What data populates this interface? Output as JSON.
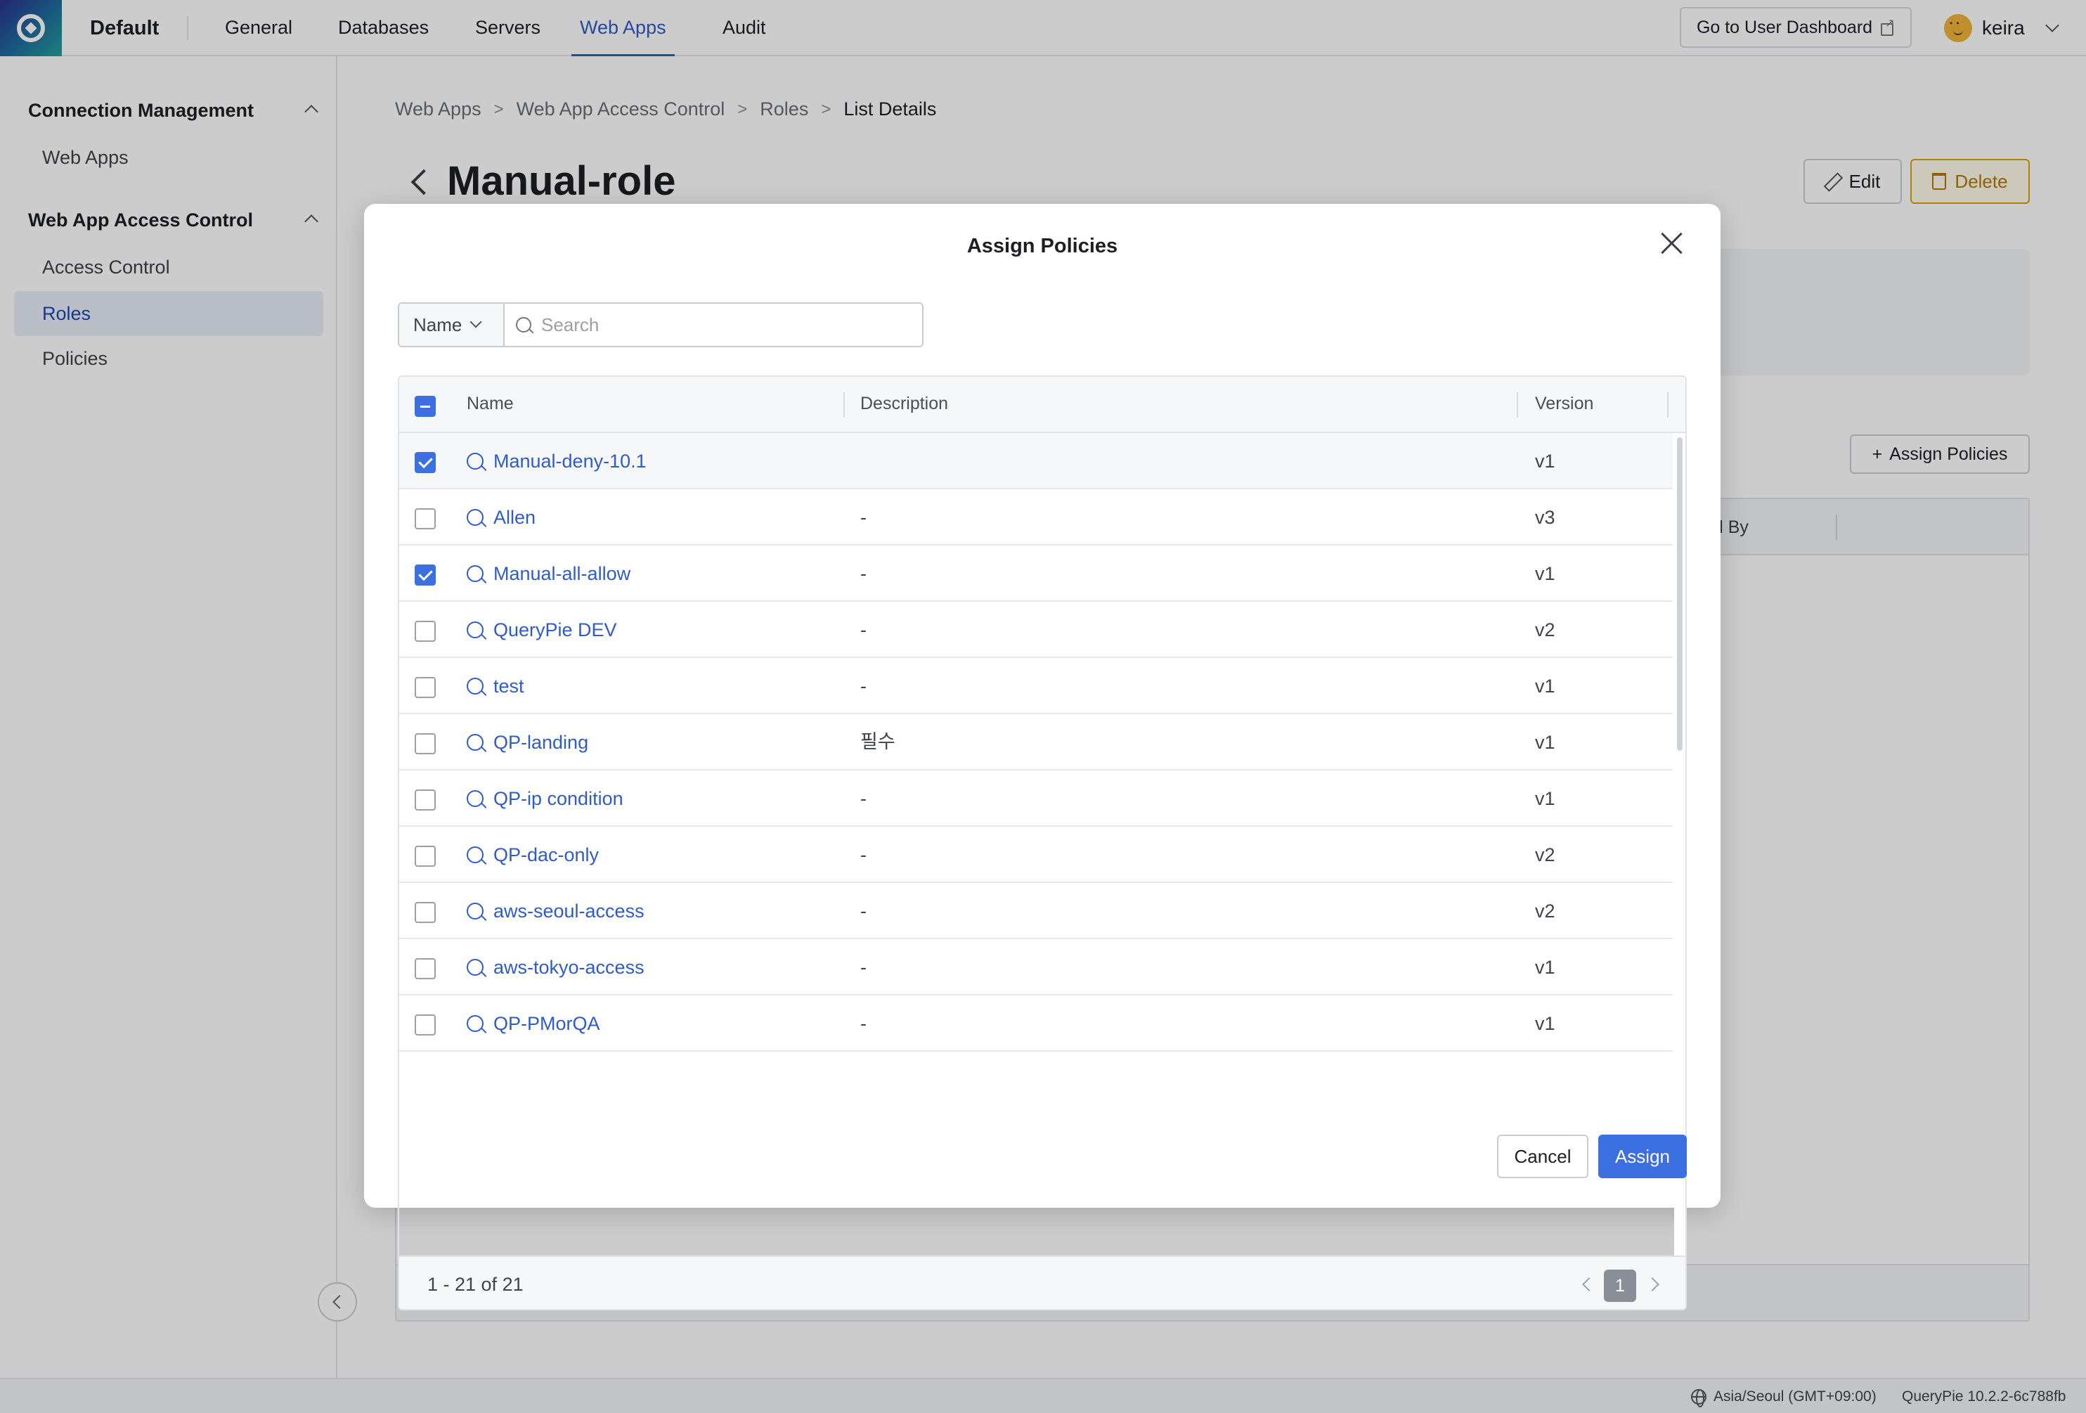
{
  "topbar": {
    "workspace": "Default",
    "tabs": [
      {
        "label": "General",
        "active": false
      },
      {
        "label": "Databases",
        "active": false
      },
      {
        "label": "Servers",
        "active": false
      },
      {
        "label": "Web Apps",
        "active": true
      },
      {
        "label": "Audit",
        "active": false
      }
    ],
    "dashboard_button": "Go to User Dashboard",
    "user_name": "keira"
  },
  "sidebar": {
    "groups": [
      {
        "label": "Connection Management",
        "items": [
          {
            "label": "Web Apps",
            "active": false
          }
        ]
      },
      {
        "label": "Web App Access Control",
        "items": [
          {
            "label": "Access Control",
            "active": false
          },
          {
            "label": "Roles",
            "active": true
          },
          {
            "label": "Policies",
            "active": false
          }
        ]
      }
    ]
  },
  "breadcrumb": [
    "Web Apps",
    "Web App Access Control",
    "Roles",
    "List Details"
  ],
  "page": {
    "title": "Manual-role",
    "edit_label": "Edit",
    "delete_label": "Delete",
    "assign_policies_label": "Assign Policies",
    "table_header_partial": "ed By"
  },
  "statusbar": {
    "timezone": "Asia/Seoul (GMT+09:00)",
    "version": "QueryPie 10.2.2-6c788fb"
  },
  "modal": {
    "title": "Assign Policies",
    "filter_field": "Name",
    "search_placeholder": "Search",
    "columns": {
      "name": "Name",
      "description": "Description",
      "version": "Version"
    },
    "rows": [
      {
        "name": "Manual-deny-10.1",
        "description": "",
        "version": "v1",
        "checked": true
      },
      {
        "name": "Allen",
        "description": "-",
        "version": "v3",
        "checked": false
      },
      {
        "name": "Manual-all-allow",
        "description": "-",
        "version": "v1",
        "checked": true
      },
      {
        "name": "QueryPie DEV",
        "description": "-",
        "version": "v2",
        "checked": false
      },
      {
        "name": "test",
        "description": "-",
        "version": "v1",
        "checked": false
      },
      {
        "name": "QP-landing",
        "description": "필수",
        "version": "v1",
        "checked": false
      },
      {
        "name": "QP-ip condition",
        "description": "-",
        "version": "v1",
        "checked": false
      },
      {
        "name": "QP-dac-only",
        "description": "-",
        "version": "v2",
        "checked": false
      },
      {
        "name": "aws-seoul-access",
        "description": "-",
        "version": "v2",
        "checked": false
      },
      {
        "name": "aws-tokyo-access",
        "description": "-",
        "version": "v1",
        "checked": false
      },
      {
        "name": "QP-PMorQA",
        "description": "-",
        "version": "v1",
        "checked": false
      }
    ],
    "count_label": "1 - 21 of 21",
    "current_page": "1",
    "cancel_label": "Cancel",
    "assign_label": "Assign"
  },
  "colors": {
    "accent": "#3c6fe0",
    "link": "#2f5bc9",
    "delete": "#b17b00"
  }
}
